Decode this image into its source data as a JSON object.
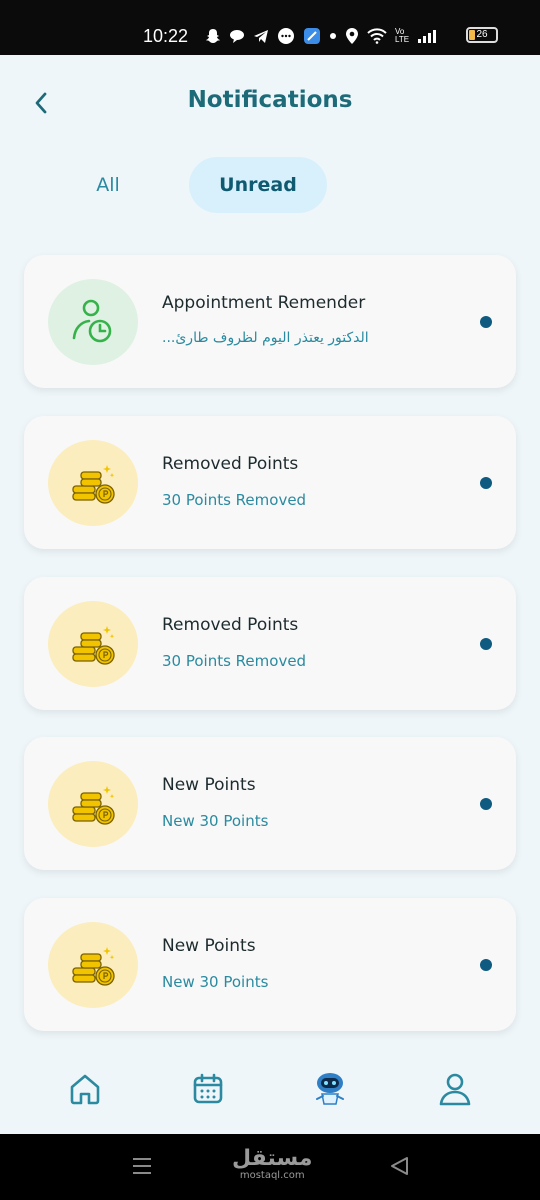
{
  "status_bar": {
    "time": "10:22",
    "battery": "26",
    "network_label": "Vo LTE"
  },
  "header": {
    "title": "Notifications",
    "back_icon": "chevron-left-icon"
  },
  "tabs": [
    {
      "label": "All",
      "active": false
    },
    {
      "label": "Unread",
      "active": true
    }
  ],
  "notifications": [
    {
      "title": "Appointment Remender",
      "subtitle": "الدكتور يعتذر اليوم لظروف طارئ...",
      "icon": "user-clock-icon",
      "unread": true
    },
    {
      "title": "Removed Points",
      "subtitle": "30 Points Removed",
      "icon": "coins-icon",
      "unread": true
    },
    {
      "title": "Removed Points",
      "subtitle": "30 Points Removed",
      "icon": "coins-icon",
      "unread": true
    },
    {
      "title": "New Points",
      "subtitle": "New 30 Points",
      "icon": "coins-icon",
      "unread": true
    },
    {
      "title": "New Points",
      "subtitle": "New 30 Points",
      "icon": "coins-icon",
      "unread": true
    }
  ],
  "bottom_nav": [
    {
      "icon": "home-icon"
    },
    {
      "icon": "calendar-icon"
    },
    {
      "icon": "robot-assistant-icon"
    },
    {
      "icon": "profile-icon"
    }
  ],
  "watermark": {
    "main": "مستقل",
    "sub": "mostaql.com"
  },
  "colors": {
    "accent": "#1d6a79",
    "tab_active_bg": "#d8f0fb",
    "unread_dot": "#0f5a80",
    "green_icon_bg": "#dff1e3",
    "yellow_icon_bg": "#fbedbd"
  }
}
